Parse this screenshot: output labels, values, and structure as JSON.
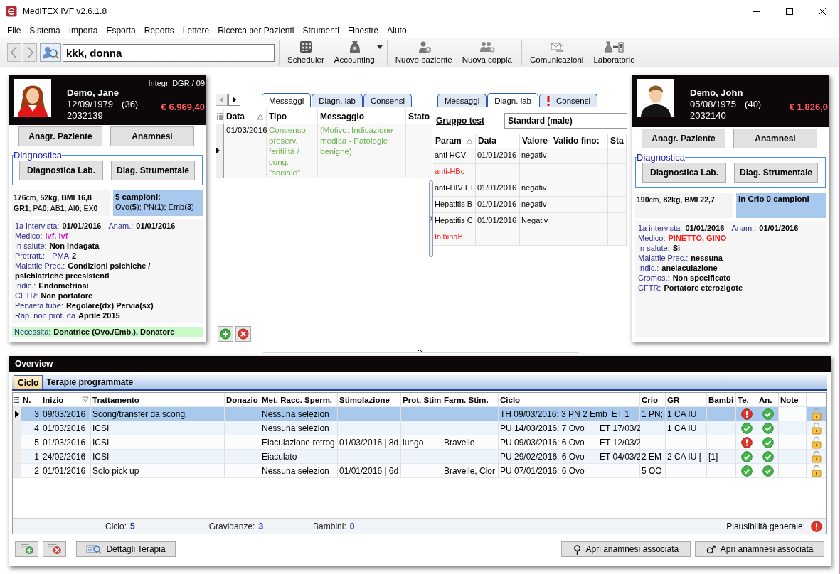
{
  "window": {
    "title": "MedITEX IVF v2.6.1.8"
  },
  "menu": [
    "File",
    "Sistema",
    "Importa",
    "Esporta",
    "Reports",
    "Lettere",
    "Ricerca per Pazienti",
    "Strumenti",
    "Finestre",
    "Aiuto"
  ],
  "toolbar": {
    "search_value": "kkk, donna",
    "tool_groups": [
      [
        {
          "label": "Scheduler",
          "dropdown": false
        },
        {
          "label": "Accounting",
          "dropdown": true
        }
      ],
      [
        {
          "label": "Nuovo paziente",
          "dropdown": false
        },
        {
          "label": "Nuova coppia",
          "dropdown": false
        }
      ],
      [
        {
          "label": "Comunicazioni",
          "dropdown": false
        },
        {
          "label": "Laboratorio",
          "dropdown": false
        }
      ]
    ]
  },
  "patients": [
    {
      "kind": "female",
      "tag": "Integr. DGR / 09",
      "name": "Demo, Jane",
      "dob": "12/09/1979",
      "age": "(36)",
      "id": "2032139",
      "balance": "€ 6.969,40",
      "buttons": [
        "Anagr. Paziente",
        "Anamnesi"
      ],
      "diagnostics": {
        "legend": "Diagnostica",
        "buttons": [
          "Diagnostica Lab.",
          "Diag. Strumentale"
        ]
      },
      "stats": [
        "**176**cm, **52kg, BMI 16,8**",
        "**GR1**; PA**0**; AB**1**; AI**0**; EX**0**"
      ],
      "samples": [
        {
          "kind": "heading",
          "text": "5 campioni:"
        },
        {
          "kind": "detail",
          "text": "Ovo(**5**); PN(**1**); Emb(**3**)"
        }
      ],
      "info": [
        {
          "fields": [
            {
              "label": "1a intervista:",
              "value": "01/01/2016"
            },
            {
              "label": "Anam.:",
              "value": "01/01/2016"
            }
          ]
        },
        {
          "fields": [
            {
              "label": "Medico:",
              "value": "ivf, ivf",
              "color": "#d424d4"
            }
          ]
        },
        {
          "fields": [
            {
              "label": "In salute:",
              "value": "Non indagata"
            }
          ]
        },
        {
          "fields": [
            {
              "label": "Pretratt.:"
            },
            {
              "label": "PMA",
              "value": "2"
            }
          ]
        },
        {
          "fields": [
            {
              "label": "Malattie Prec.:",
              "value": "Condizioni psichiche / psichiatriche preesistenti"
            }
          ]
        },
        {
          "fields": [
            {
              "label": "Indic.:",
              "value": "Endometriosi"
            }
          ]
        },
        {
          "fields": [
            {
              "label": "CFTR:",
              "value": "Non portatore"
            }
          ]
        },
        {
          "fields": [
            {
              "label": "Pervieta tube:",
              "value": "Regolare(dx) Pervia(sx)"
            }
          ]
        },
        {
          "fields": [
            {
              "label": "Rap. non prot. da",
              "value": "Aprile 2015"
            }
          ]
        }
      ],
      "needs": {
        "label": "Necessita:",
        "value": "Donatrice (Ovo./Emb.), Donatore"
      }
    },
    {
      "kind": "male",
      "name": "Demo, John",
      "dob": "05/08/1975",
      "age": "(40)",
      "id": "2032140",
      "balance": "€ 1.826,0",
      "buttons": [
        "Anagr. Paziente",
        "Anamnesi"
      ],
      "diagnostics": {
        "legend": "Diagnostica",
        "buttons": [
          "Diagnostica Lab.",
          "Diag. Strumentale"
        ]
      },
      "stats": [
        "**190**cm, **82kg, BMI 22,7**"
      ],
      "samples": [
        {
          "kind": "heading",
          "text": "In Crio 0 campioni"
        }
      ],
      "info": [
        {
          "fields": [
            {
              "label": "1a intervista:",
              "value": "01/01/2016"
            },
            {
              "label": "Anam.:",
              "value": "01/01/2016"
            }
          ]
        },
        {
          "fields": [
            {
              "label": "Medico:",
              "value": "PINETTO, GINO",
              "color": "#ff1a1a"
            }
          ]
        },
        {
          "fields": [
            {
              "label": "In salute:",
              "value": "Si"
            }
          ]
        },
        {
          "fields": [
            {
              "label": "Malattie Prec.:",
              "value": "nessuna"
            }
          ]
        },
        {
          "fields": [
            {
              "label": "Indic.:",
              "value": "aneiaculazione"
            }
          ]
        },
        {
          "fields": [
            {
              "label": "Cromos.:",
              "value": "Non specificato"
            }
          ]
        },
        {
          "fields": [
            {
              "label": "CFTR:",
              "value": "Portatore eterozigote"
            }
          ]
        }
      ]
    }
  ],
  "messages_panel": {
    "tabs": [
      {
        "label": "Messaggi",
        "selected": true
      },
      {
        "label": "Diagn. lab",
        "selected": false
      },
      {
        "label": "Consensi",
        "selected": false
      }
    ],
    "columns": [
      {
        "label": "Data",
        "kind": "sorted-asc"
      },
      {
        "label": "Tipo",
        "kind": "plain"
      },
      {
        "label": "Messaggio",
        "kind": "plain"
      },
      {
        "label": "Stato",
        "kind": "plain"
      }
    ],
    "rows": [
      {
        "selected": true,
        "data": "01/03/2016",
        "tipo": "Consenso preserv. feritilità / cong. \"sociale\"",
        "messaggio": "(Motivo: Indicazione medica - Patologie benigne)"
      }
    ]
  },
  "lab_panel": {
    "tabs": [
      {
        "label": "Messaggi",
        "selected": false,
        "warning": false
      },
      {
        "label": "Diagn. lab",
        "selected": true,
        "warning": false
      },
      {
        "label": "Consensi",
        "selected": false,
        "warning": true
      }
    ],
    "group_label": "Gruppo test",
    "group_value": "Standard (male)",
    "columns": [
      {
        "label": "Param",
        "kind": "sorted-asc"
      },
      {
        "label": "Data",
        "kind": "plain"
      },
      {
        "label": "Valore",
        "kind": "plain"
      },
      {
        "label": "Valido fino:",
        "kind": "plain"
      },
      {
        "label": "Sta",
        "kind": "plain"
      }
    ],
    "rows": [
      {
        "param": "anti HCV",
        "data": "01/01/2016",
        "valore": "negativ",
        "missing": false
      },
      {
        "param": "anti-HBc",
        "missing": true
      },
      {
        "param": "anti-HIV I +",
        "data": "01/01/2016",
        "valore": "negativ",
        "missing": false
      },
      {
        "param": "Hepatitis B",
        "data": "01/01/2016",
        "valore": "negativ",
        "missing": false
      },
      {
        "param": "Hepatitis C",
        "data": "01/01/2016",
        "valore": "Negativ",
        "missing": false
      },
      {
        "param": "InibinaB",
        "missing": true
      }
    ]
  },
  "overview": {
    "title": "Overview",
    "tabs": [
      {
        "label": "Ciclo",
        "selected": true
      },
      {
        "label": "Terapie programmate",
        "selected": false
      }
    ],
    "columns": [
      {
        "label": "N.",
        "kind": "plain"
      },
      {
        "label": "Inizio",
        "kind": "sorted-desc"
      },
      {
        "label": "Trattamento",
        "kind": "plain"
      },
      {
        "label": "Donazio",
        "kind": "plain"
      },
      {
        "label": "Met. Racc. Sperm.",
        "kind": "plain"
      },
      {
        "label": "Stimolazione",
        "kind": "plain"
      },
      {
        "label": "Prot. Stim",
        "kind": "plain"
      },
      {
        "label": "Farm. Stim.",
        "kind": "plain"
      },
      {
        "label": "Ciclo",
        "kind": "plain"
      },
      {
        "label": "Crio",
        "kind": "plain"
      },
      {
        "label": "GR",
        "kind": "plain"
      },
      {
        "label": "Bambi",
        "kind": "plain"
      },
      {
        "label": "Te.",
        "kind": "plain"
      },
      {
        "label": "An.",
        "kind": "plain"
      },
      {
        "label": "Note",
        "kind": "plain"
      }
    ],
    "rows": [
      {
        "selected": true,
        "n": "3",
        "inizio": "09/03/2016",
        "trattamento": "Scong/transfer da scong.",
        "met": "Nessuna selezion",
        "ciclo": "TH 09/03/2016: 3 PN 2 Emb",
        "ciclo_et": "ET 1",
        "crio": "1 PN;",
        "gr": "1 CA IU",
        "te_ok": false,
        "an_ok": true
      },
      {
        "selected": false,
        "n": "4",
        "inizio": "01/03/2016",
        "trattamento": "ICSI",
        "met": "Nessuna selezion",
        "ciclo": "PU 14/03/2016: 7 Ovo",
        "ciclo_et": "ET 17/03/2",
        "gr": "1 CA IU",
        "te_ok": true,
        "an_ok": true
      },
      {
        "selected": false,
        "n": "5",
        "inizio": "01/03/2016",
        "trattamento": "ICSI",
        "met": "Eiaculazione retrog",
        "stimolazione": "01/03/2016 | 8d",
        "prot": "lungo",
        "farm": "Bravelle",
        "ciclo": "PU 09/03/2016: 6 Ovo",
        "ciclo_et": "ET 12/03/2",
        "te_ok": false,
        "an_ok": true
      },
      {
        "selected": false,
        "n": "1",
        "inizio": "24/02/2016",
        "trattamento": "ICSI",
        "met": "Eiaculato",
        "ciclo": "PU 29/02/2016: 6 Ovo",
        "ciclo_et": "ET 04/03/2",
        "crio": "2 EM",
        "gr": "2 CA IU [",
        "bambini": "[1]",
        "te_ok": true,
        "an_ok": true
      },
      {
        "selected": false,
        "n": "2",
        "inizio": "01/01/2016",
        "trattamento": "Solo pick up",
        "met": "Nessuna selezion",
        "stimolazione": "01/01/2016 | 6d",
        "farm": "Bravelle, Clor",
        "ciclo": "PU 07/01/2016: 6 Ovo",
        "crio": "5 OO",
        "te_ok": true,
        "an_ok": true
      }
    ],
    "summary": [
      {
        "label": "Ciclo:",
        "value": "5"
      },
      {
        "label": "Gravidanze:",
        "value": "3"
      },
      {
        "label": "Bambini:",
        "value": "0"
      }
    ],
    "plausibility": {
      "label": "Plausibilità generale:",
      "ok": false
    },
    "details_button": "Dettagli Terapia",
    "history_buttons": [
      {
        "symbol": "♀",
        "label": "Apri anamnesi associata"
      },
      {
        "symbol": "♂",
        "label": "Apri anamnesi associata"
      }
    ]
  }
}
